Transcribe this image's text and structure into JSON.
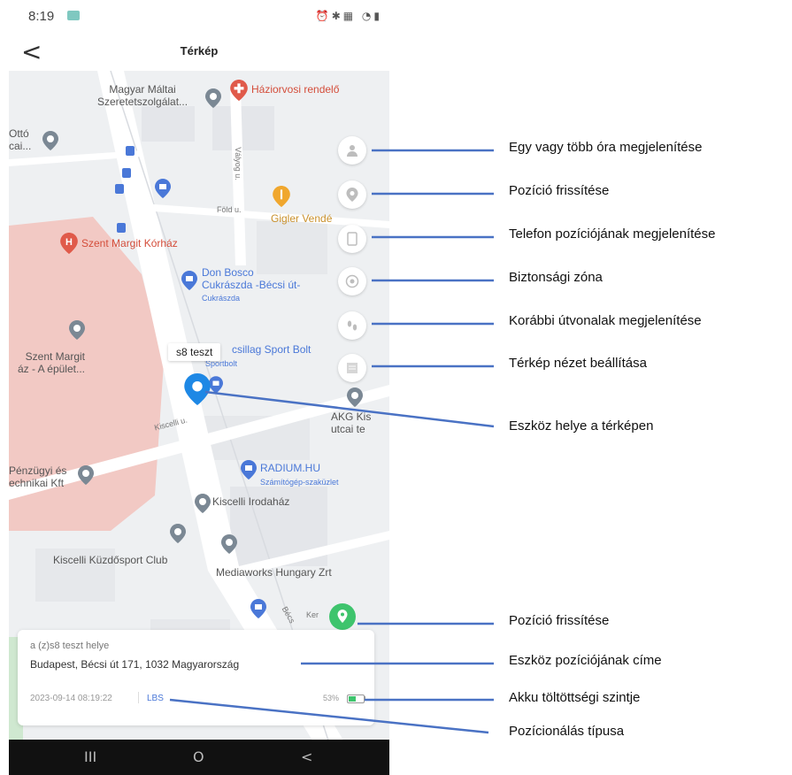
{
  "status_bar": {
    "time": "8:19"
  },
  "header": {
    "back_symbol": "<",
    "title": "Térkép"
  },
  "map": {
    "labels": {
      "maltai": "Magyar Máltai\nSzeretetszolgálat...",
      "haziorvos": "Háziorvosi rendelő",
      "otto": "Ottó\ncai...",
      "valyog": "Vályog u.",
      "fold": "Föld u.",
      "gigler": "Gigler Vendé",
      "szent_margit_korhaz": "Szent Margit Kórház",
      "don_bosco": "Don Bosco\nCukrászda -Bécsi út-",
      "cukraszda": "Cukrászda",
      "szent_margit_epulet": "Szent Margit\náz - A épület...",
      "sport_bolt": "csillag Sport Bolt",
      "sportbolt_small": "Sportbolt",
      "akg": "AKG Kis\nutcai te",
      "kiscelli_u": "Kiscelli u.",
      "penzugyi": "Pénzügyi és\nechnikai Kft",
      "radium": "RADIUM.HU",
      "szamitogep": "Számítógép-szaküzlet",
      "kiscelli_irodahaz": "Kiscelli Irodaház",
      "kuzdosport": "Kiscelli Küzdősport Club",
      "mediaworks": "Mediaworks Hungary Zrt",
      "becsi": "Bécs",
      "ker": "Ker"
    },
    "device_tooltip": "s8 teszt"
  },
  "side_buttons": [
    {
      "icon": "person-icon"
    },
    {
      "icon": "location-pin-icon"
    },
    {
      "icon": "phone-icon"
    },
    {
      "icon": "safe-zone-icon"
    },
    {
      "icon": "footprints-icon"
    },
    {
      "icon": "layers-icon"
    }
  ],
  "info_card": {
    "title": "a (z)s8 teszt helye",
    "address": "Budapest, Bécsi út 171, 1032 Magyarország",
    "timestamp": "2023-09-14 08:19:22",
    "positioning_type": "LBS",
    "battery_percent_label": "53%",
    "battery_level": 0.53
  },
  "navbar": {
    "recents": "III",
    "home": "O",
    "back": "<"
  },
  "annotations": [
    "Egy vagy több óra megjelenítése",
    "Pozíció frissítése",
    "Telefon pozíciójának megjelenítése",
    "Biztonsági zóna",
    "Korábbi útvonalak megjelenítése",
    "Térkép nézet beállítása",
    "Eszköz helye a térképen",
    "Pozíció frissítése",
    "Eszköz pozíciójának címe",
    "Akku töltöttségi szintje",
    "Pozícionálás típusa"
  ],
  "colors": {
    "annotation_line": "#4a72c4",
    "device_pin": "#1e88e5",
    "refresh_pin": "#3ec46d",
    "hospital_area": "#f2c9c4",
    "map_background": "#eef0f2"
  }
}
